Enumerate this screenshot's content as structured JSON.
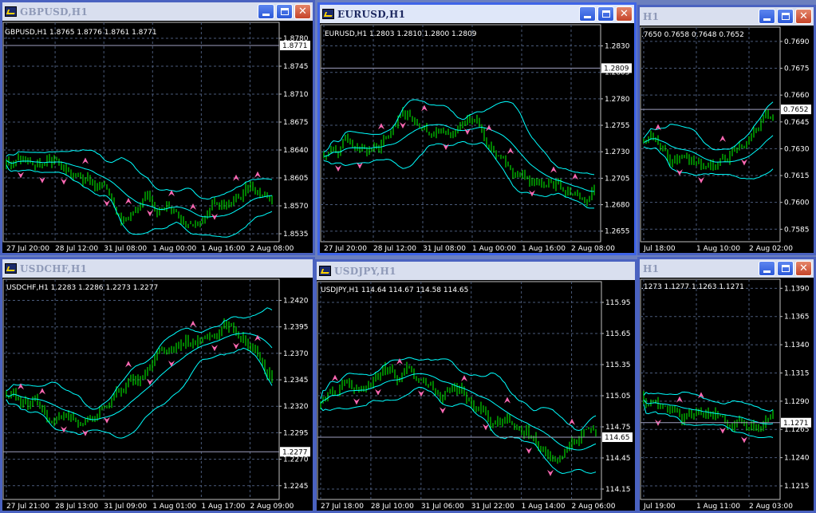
{
  "windows": [
    {
      "id": "gbpusd",
      "title": "GBPUSD,H1",
      "active": false,
      "info": "GBPUSD,H1  1.8765 1.8776 1.8761 1.8771",
      "yticks": [
        "1.8780",
        "1.8745",
        "1.8710",
        "1.8675",
        "1.8640",
        "1.8605",
        "1.8570",
        "1.8535"
      ],
      "xticks": [
        "27 Jul 20:00",
        "28 Jul 12:00",
        "31 Jul 08:00",
        "1 Aug 00:00",
        "1 Aug 16:00",
        "2 Aug 08:00"
      ],
      "price": "1.8771",
      "range": [
        1.8525,
        1.88
      ],
      "seed": 3
    },
    {
      "id": "eurusd",
      "title": "EURUSD,H1",
      "active": true,
      "info": "EURUSD,H1  1.2803 1.2810 1.2800 1.2809",
      "yticks": [
        "1.2830",
        "1.2805",
        "1.2780",
        "1.2755",
        "1.2730",
        "1.2705",
        "1.2680",
        "1.2655"
      ],
      "xticks": [
        "27 Jul 20:00",
        "28 Jul 12:00",
        "31 Jul 08:00",
        "1 Aug 00:00",
        "1 Aug 16:00",
        "2 Aug 08:00"
      ],
      "price": "1.2809",
      "range": [
        1.2645,
        1.285
      ],
      "seed": 7
    },
    {
      "id": "third",
      "title": "H1",
      "active": false,
      "info": ".7650 0.7658 0.7648 0.7652",
      "yticks": [
        "0.7690",
        "0.7675",
        "0.7660",
        "0.7645",
        "0.7630",
        "0.7615",
        "0.7600",
        "0.7585"
      ],
      "xticks": [
        "Jul 18:00",
        "1 Aug 10:00",
        "2 Aug 02:00"
      ],
      "price": "0.7652",
      "range": [
        0.7578,
        0.7698
      ],
      "seed": 11
    },
    {
      "id": "usdchf",
      "title": "USDCHF,H1",
      "active": false,
      "info": "USDCHF,H1  1.2283 1.2286 1.2273 1.2277",
      "yticks": [
        "1.2420",
        "1.2395",
        "1.2370",
        "1.2345",
        "1.2320",
        "1.2295",
        "1.2270",
        "1.2245"
      ],
      "xticks": [
        "27 Jul 21:00",
        "28 Jul 13:00",
        "31 Jul 09:00",
        "1 Aug 01:00",
        "1 Aug 17:00",
        "2 Aug 09:00"
      ],
      "price": "1.2277",
      "range": [
        1.2232,
        1.244
      ],
      "seed": 5
    },
    {
      "id": "usdjpy",
      "title": "USDJPY,H1",
      "active": false,
      "info": "USDJPY,H1  114.64 114.67 114.58 114.65",
      "yticks": [
        "115.95",
        "115.65",
        "115.35",
        "115.05",
        "114.75",
        "114.45",
        "114.15"
      ],
      "xticks": [
        "27 Jul 18:00",
        "28 Jul 10:00",
        "31 Jul 06:00",
        "31 Jul 22:00",
        "1 Aug 14:00",
        "2 Aug 06:00"
      ],
      "price": "114.65",
      "range": [
        114.05,
        116.15
      ],
      "seed": 13
    },
    {
      "id": "sixth",
      "title": "H1",
      "active": false,
      "info": ".1273 1.1277 1.1263 1.1271",
      "yticks": [
        "1.1390",
        "1.1365",
        "1.1340",
        "1.1315",
        "1.1290",
        "1.1265",
        "1.1240",
        "1.1215"
      ],
      "xticks": [
        "Jul 19:00",
        "1 Aug 11:00",
        "2 Aug 03:00"
      ],
      "price": "1.1271",
      "range": [
        1.1203,
        1.1398
      ],
      "seed": 17
    }
  ],
  "colors": {
    "candle": "#00ff00",
    "band": "#00ffff",
    "arrow": "#ff69b4",
    "grid": "#4a5a7a",
    "text": "#ffffff",
    "priceLabelBg": "#ffffff"
  }
}
